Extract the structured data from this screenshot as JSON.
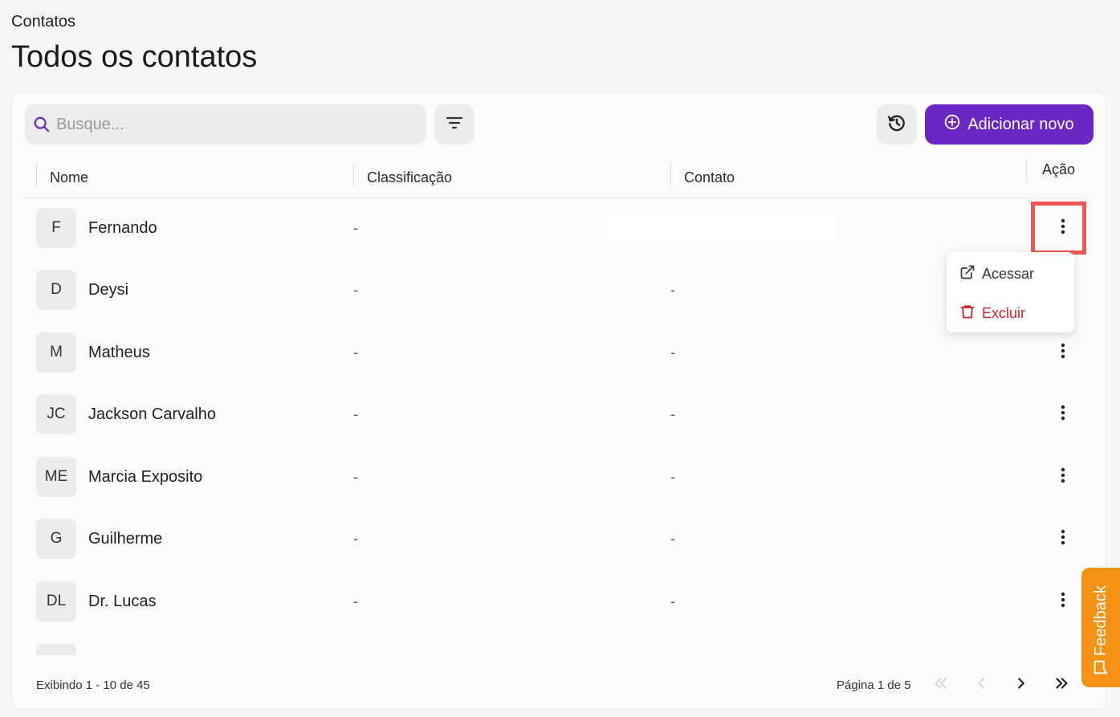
{
  "header": {
    "breadcrumb": "Contatos",
    "title": "Todos os contatos"
  },
  "toolbar": {
    "search_placeholder": "Busque...",
    "add_label": "Adicionar novo",
    "accent_color": "#6a27c4"
  },
  "table": {
    "columns": [
      "Nome",
      "Classificação",
      "Contato",
      "Ação"
    ],
    "rows": [
      {
        "initials": "F",
        "name": "Fernando",
        "classification": "-",
        "contact": ""
      },
      {
        "initials": "D",
        "name": "Deysi",
        "classification": "-",
        "contact": "-"
      },
      {
        "initials": "M",
        "name": "Matheus",
        "classification": "-",
        "contact": "-"
      },
      {
        "initials": "JC",
        "name": "Jackson Carvalho",
        "classification": "-",
        "contact": "-"
      },
      {
        "initials": "ME",
        "name": "Marcia Exposito",
        "classification": "-",
        "contact": "-"
      },
      {
        "initials": "G",
        "name": "Guilherme",
        "classification": "-",
        "contact": "-"
      },
      {
        "initials": "DL",
        "name": "Dr. Lucas",
        "classification": "-",
        "contact": "-"
      }
    ]
  },
  "row_menu": {
    "access_label": "Acessar",
    "delete_label": "Excluir",
    "delete_color": "#d0222a"
  },
  "footer": {
    "showing": "Exibindo 1 - 10 de 45",
    "page": "Página 1 de 5"
  },
  "feedback": {
    "label": "Feedback",
    "color": "#f39215"
  }
}
